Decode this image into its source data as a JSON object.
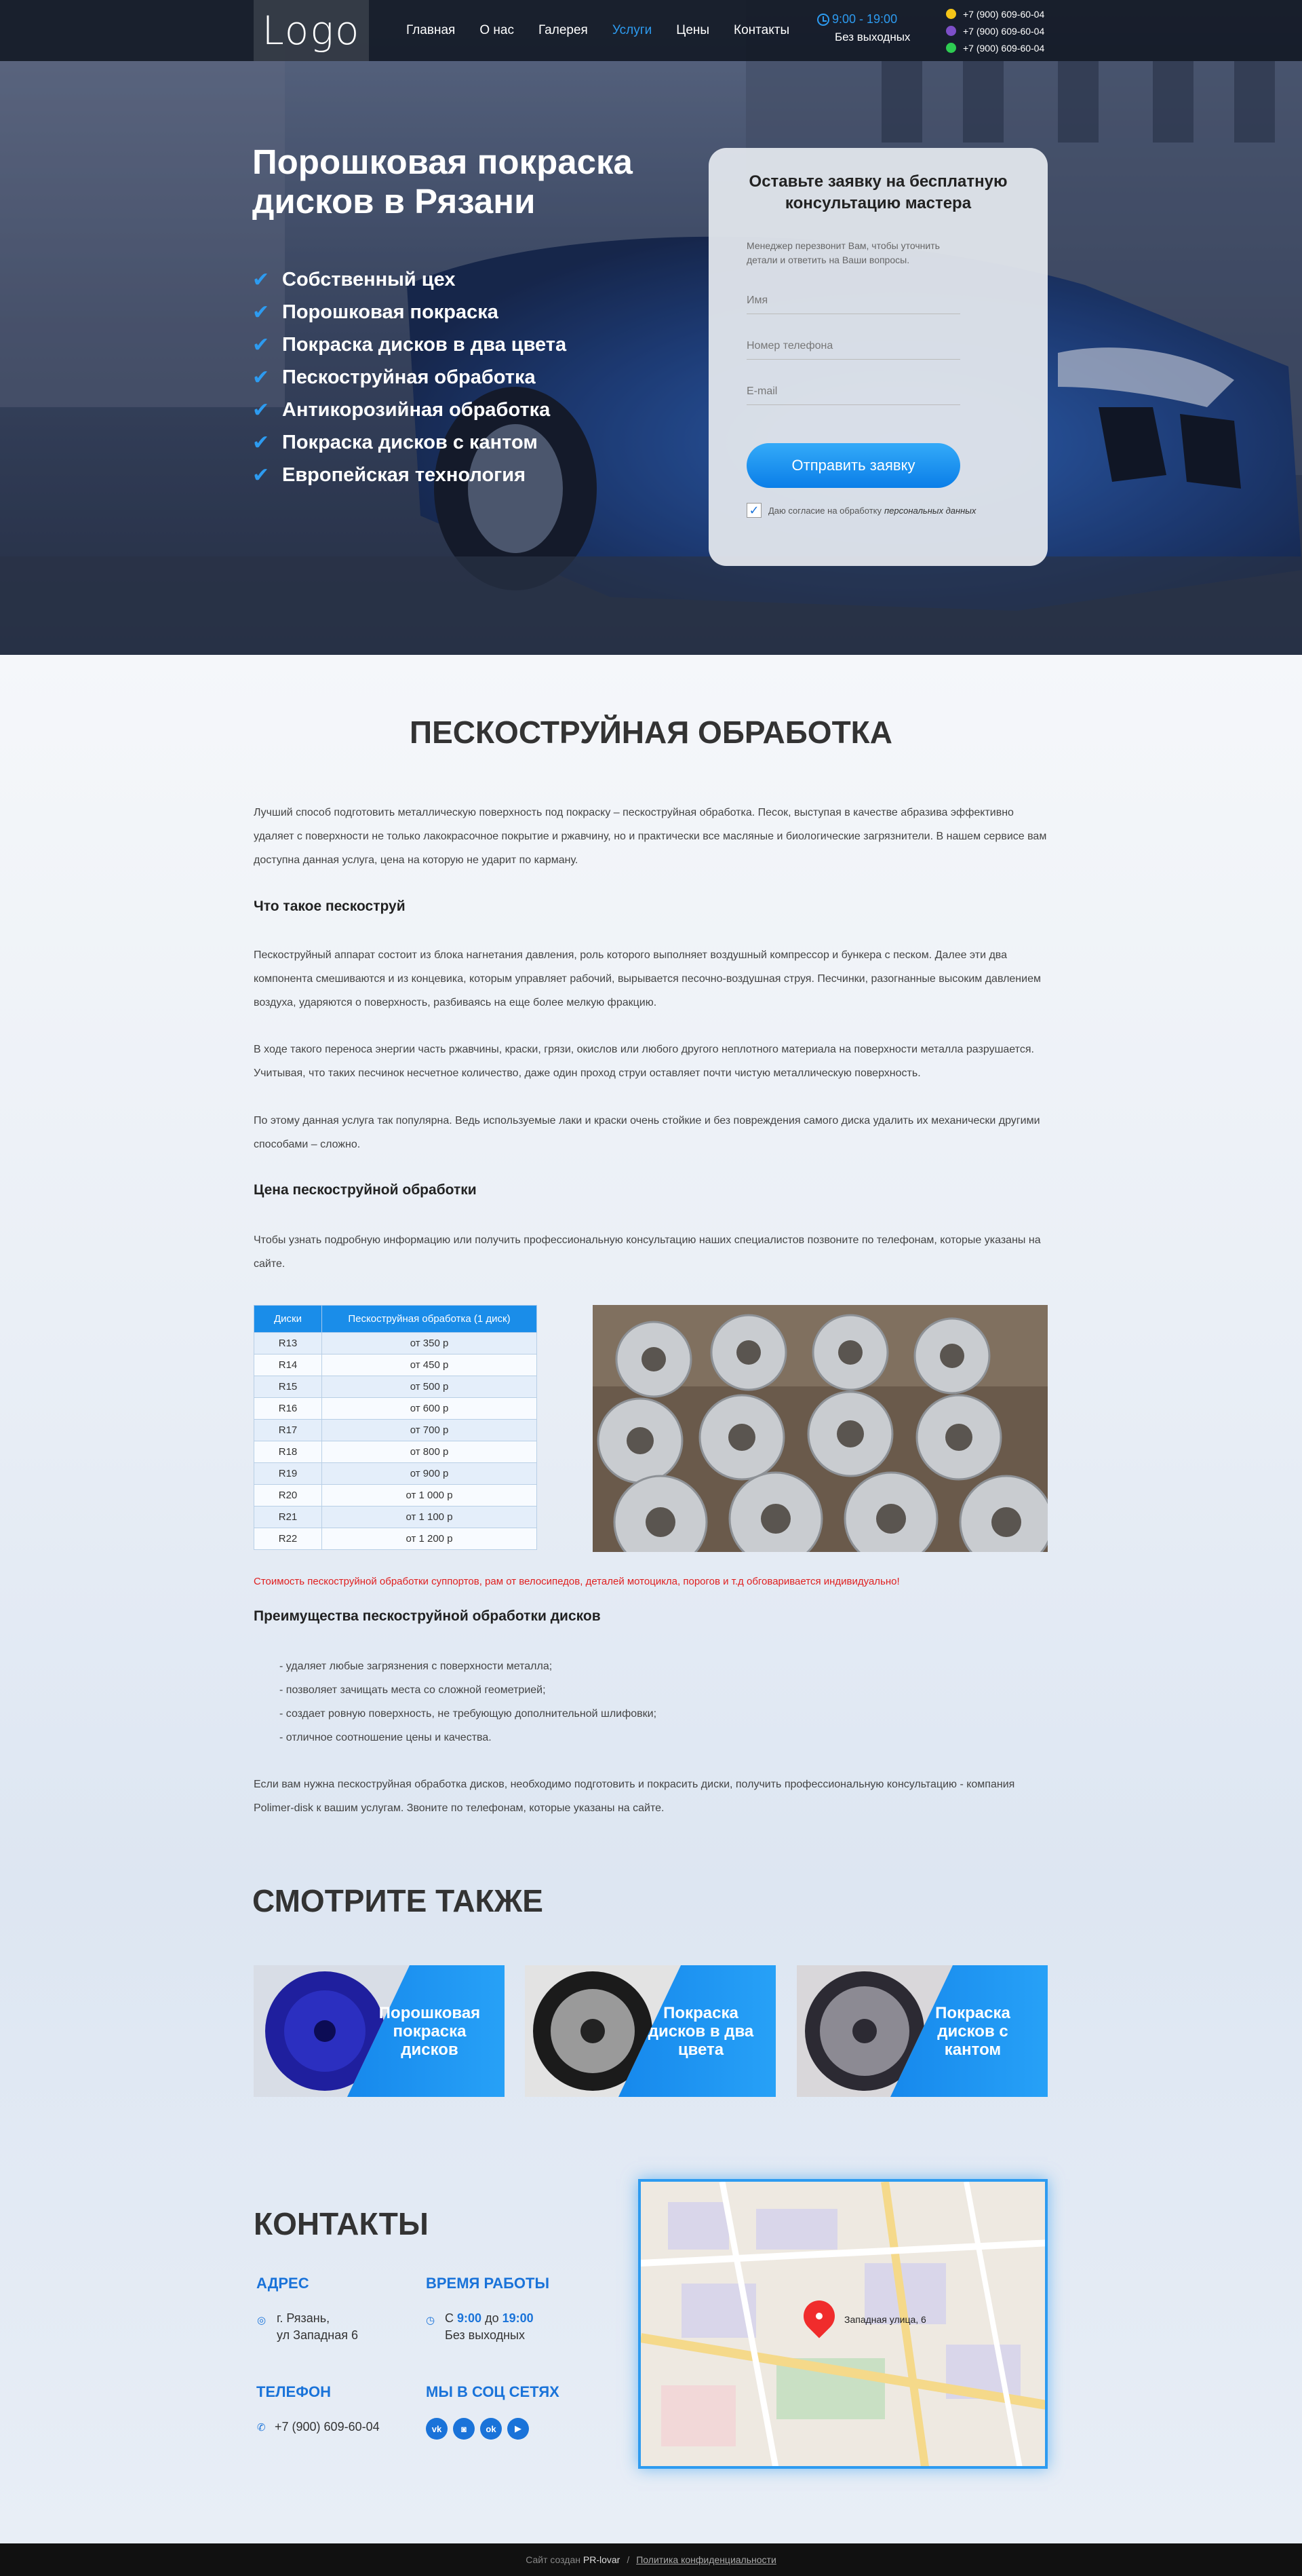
{
  "header": {
    "logo": "Logo",
    "nav": [
      "Главная",
      "О нас",
      "Галерея",
      "Услуги",
      "Цены",
      "Контакты"
    ],
    "active_nav": "Услуги",
    "hours_time": "9:00 - 19:00",
    "hours_days": "Без выходных",
    "phones": [
      "+7 (900) 609-60-04",
      "+7 (900) 609-60-04",
      "+7 (900) 609-60-04"
    ]
  },
  "hero": {
    "title_line1": "Порошковая покраска",
    "title_line2": "дисков в Рязани",
    "benefits": [
      "Собственный цех",
      "Порошковая покраска",
      "Покраска дисков в два цвета",
      "Пескоструйная обработка",
      "Антикорозийная обработка",
      "Покраска дисков с кантом",
      "Европейская технология"
    ]
  },
  "form": {
    "title": "Оставьте заявку на бесплатную консультацию мастера",
    "subtitle": "Менеджер перезвонит Вам, чтобы уточнить детали и ответить на Ваши вопросы.",
    "name_placeholder": "Имя",
    "phone_placeholder": "Номер телефона",
    "email_placeholder": "E-mail",
    "submit": "Отправить заявку",
    "consent_text": "Даю согласие на обработку",
    "consent_link": "персональных данных"
  },
  "main": {
    "title": "ПЕСКОСТРУЙНАЯ ОБРАБОТКА",
    "intro": "Лучший способ подготовить металлическую поверхность под покраску – пескоструйная обработка. Песок, выступая в качестве абразива эффективно удаляет с поверхности не только лакокрасочное покрытие и ржавчину, но и практически все масляные и биологические загрязнители. В нашем сервисе вам доступна данная услуга, цена на которую не ударит по карману.",
    "what_title": "Что такое пескоструй",
    "what_p1": "Пескоструйный аппарат состоит из блока нагнетания давления, роль которого выполняет воздушный компрессор и бункера с песком. Далее эти два компонента смешиваются и из концевика, которым управляет рабочий, вырывается песочно-воздушная струя. Песчинки, разогнанные высоким давлением воздуха, ударяются о поверхность, разбиваясь на еще более мелкую фракцию.",
    "what_p2": "В ходе такого переноса энергии часть ржавчины, краски, грязи, окислов или любого другого неплотного материала на поверхности металла разрушается. Учитывая, что таких песчинок несчетное количество, даже один проход струи оставляет почти чистую металлическую поверхность.",
    "what_p3": "По этому данная услуга так популярна. Ведь используемые лаки и краски очень стойкие и без повреждения самого диска удалить их механически другими способами – сложно.",
    "price_title": "Цена пескоструйной обработки",
    "price_p": "Чтобы узнать подробную информацию или получить профессиональную консультацию наших специалистов позвоните по телефонам, которые указаны на сайте.",
    "table_headers": [
      "Диски",
      "Пескоструйная обработка (1 диск)"
    ],
    "table_rows": [
      [
        "R13",
        "от 350 р"
      ],
      [
        "R14",
        "от 450 р"
      ],
      [
        "R15",
        "от 500 р"
      ],
      [
        "R16",
        "от 600 р"
      ],
      [
        "R17",
        "от 700 р"
      ],
      [
        "R18",
        "от 800 р"
      ],
      [
        "R19",
        "от 900 р"
      ],
      [
        "R20",
        "от 1 000 р"
      ],
      [
        "R21",
        "от 1 100 р"
      ],
      [
        "R22",
        "от 1 200 р"
      ]
    ],
    "note": "Стоимость пескоструйной обработки суппортов, рам от велосипедов, деталей мотоцикла, порогов и т.д обговаривается индивидуально!",
    "adv_title": "Преимущества пескоструйной обработки дисков",
    "adv_list": [
      "- удаляет любые загрязнения с поверхности металла;",
      "- позволяет зачищать места со сложной геометрией;",
      "- создает ровную поверхность, не требующую дополнительной шлифовки;",
      "- отличное соотношение цены и качества."
    ],
    "outro": "Если вам нужна пескоструйная обработка дисков, необходимо подготовить и покрасить диски, получить профессиональную консультацию - компания Polimer-disk к вашим услугам. Звоните по телефонам, которые указаны на сайте."
  },
  "see_also": {
    "title": "СМОТРИТЕ ТАКЖЕ",
    "cards": [
      "Порошковая покраска дисков",
      "Покраска дисков в два цвета",
      "Покраска дисков с кантом"
    ]
  },
  "contacts": {
    "title": "КОНТАКТЫ",
    "address_head": "АДРЕС",
    "address_line1": "г. Рязань,",
    "address_line2": "ул Западная 6",
    "hours_head": "ВРЕМЯ РАБОТЫ",
    "hours_from": "9:00",
    "hours_to": "19:00",
    "hours_c": "С",
    "hours_do": "до",
    "hours_days": "Без выходных",
    "phone_head": "ТЕЛЕФОН",
    "phone": "+7 (900) 609-60-04",
    "social_head": "МЫ В СОЦ СЕТЯХ",
    "social": [
      "vk",
      "ig",
      "ok",
      "yt"
    ],
    "map_label": "Западная улица, 6"
  },
  "footer": {
    "made_by": "Сайт создан",
    "studio": "PR-lovar",
    "sep": "/",
    "policy": "Политика конфиденциальности"
  },
  "colors": {
    "accent": "#2d9bf0",
    "button": "#0a7ee8",
    "header_bg": "#141a26",
    "alert": "#e02020"
  }
}
